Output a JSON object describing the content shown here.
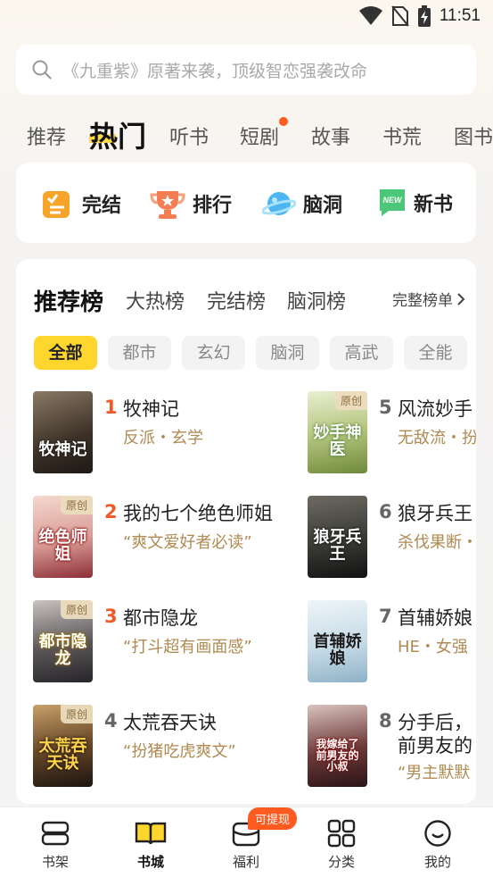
{
  "status": {
    "time": "11:51"
  },
  "search": {
    "placeholder": "《九重紫》原著来袭，顶级智恋强袭改命"
  },
  "tabs": [
    "推荐",
    "热门",
    "听书",
    "短剧",
    "故事",
    "书荒",
    "图书"
  ],
  "active_tab": "热门",
  "quick_entries": [
    {
      "label": "完结",
      "icon": "checklist-icon"
    },
    {
      "label": "排行",
      "icon": "trophy-icon"
    },
    {
      "label": "脑洞",
      "icon": "planet-icon"
    },
    {
      "label": "新书",
      "icon": "new-tag-icon"
    }
  ],
  "ranking": {
    "tabs": [
      "推荐榜",
      "大热榜",
      "完结榜",
      "脑洞榜"
    ],
    "full_link": "完整榜单",
    "chips": [
      "全部",
      "都市",
      "玄幻",
      "脑洞",
      "高武",
      "全能"
    ],
    "books": [
      {
        "rank": "1",
        "title": "牧神记",
        "sub": "反派・玄学",
        "badge": "",
        "cover_text": "牧神记"
      },
      {
        "rank": "2",
        "title": "我的七个绝色师姐",
        "sub": "“爽文爱好者必读”",
        "badge": "原创",
        "cover_text": "绝色师姐"
      },
      {
        "rank": "3",
        "title": "都市隐龙",
        "sub": "“打斗超有画面感”",
        "badge": "原创",
        "cover_text": "都市隐龙"
      },
      {
        "rank": "4",
        "title": "太荒吞天诀",
        "sub": "“扮猪吃虎爽文”",
        "badge": "原创",
        "cover_text": "太荒吞天诀"
      },
      {
        "rank": "5",
        "title": "风流妙手",
        "sub": "无敌流・扮",
        "badge": "原创",
        "cover_text": "妙手神医"
      },
      {
        "rank": "6",
        "title": "狼牙兵王",
        "sub": "杀伐果断・",
        "badge": "",
        "cover_text": "狼牙兵王"
      },
      {
        "rank": "7",
        "title": "首辅娇娘",
        "sub": "HE・女强",
        "badge": "",
        "cover_text": "首辅娇娘"
      },
      {
        "rank": "8",
        "title": "分手后，",
        "title2": "前男友的",
        "sub": "“男主默默",
        "badge": "",
        "cover_text": "我嫁给了前男友的小叔"
      }
    ]
  },
  "bottom_nav": {
    "items": [
      "书架",
      "书城",
      "福利",
      "分类",
      "我的"
    ],
    "active": "书城",
    "badge": "可提现"
  },
  "colors": {
    "accent": "#ffd62e",
    "hot": "#f05a2a",
    "sub": "#b08a52"
  }
}
